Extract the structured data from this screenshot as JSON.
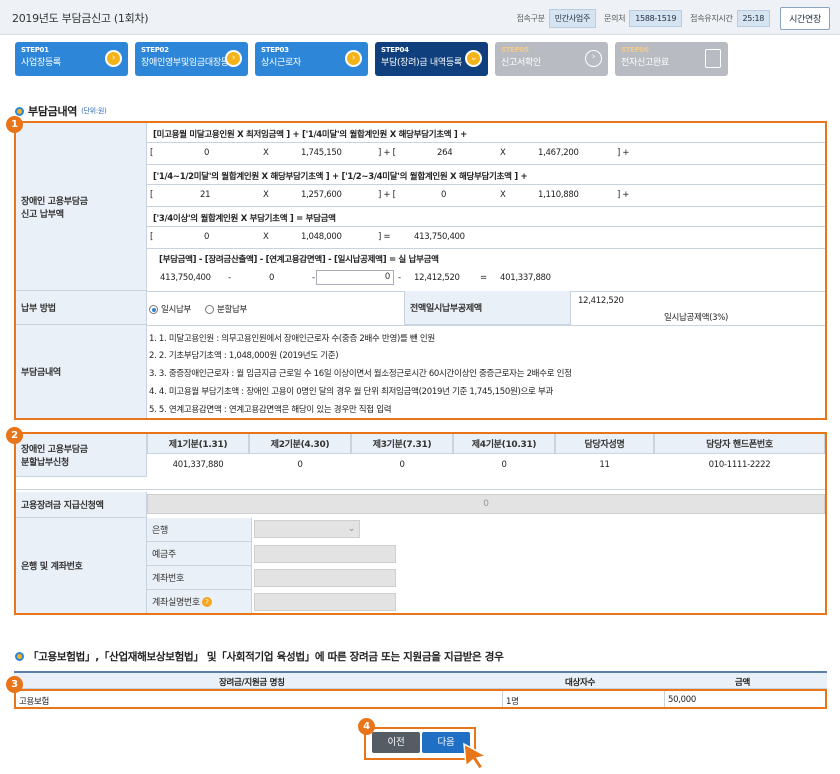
{
  "header": {
    "title": "2019년도 부담금신고 (1회차)",
    "info": [
      {
        "label": "접속구분",
        "value": "민간사업주"
      },
      {
        "label": "문의처",
        "value": "1588-1519"
      },
      {
        "label": "접속유지시간",
        "value": "25:18"
      }
    ],
    "extend": "시간연장"
  },
  "steps": [
    {
      "no": "STEP01",
      "name": "사업장등록"
    },
    {
      "no": "STEP02",
      "name": "장애인영부및임금대장등록"
    },
    {
      "no": "STEP03",
      "name": "상시근로자"
    },
    {
      "no": "STEP04",
      "name": "부담(장려)금 내역등록"
    },
    {
      "no": "STEP05",
      "name": "신고서확인"
    },
    {
      "no": "STEP06",
      "name": "전자신고완료"
    }
  ],
  "section1": {
    "title": "부담금내역",
    "unit": "(단위:원)"
  },
  "badges": [
    "1",
    "2",
    "3",
    "4"
  ],
  "calc": {
    "label": "장애인 고용부담금\n신고 납부액",
    "f1": "[미고용월 미달고용인원 X  최저임금액  ] + ['1/4미달'의 월합계인원 X   해당부담기초액  ] +",
    "r1": [
      "[",
      "0",
      "X",
      "1,745,150",
      "] + [",
      "264",
      "X",
      "1,467,200",
      "] +"
    ],
    "f2": "['1/4~1/2미달'의 월합계인원 X   해당부담기초액  ] + ['1/2~3/4미달'의 월합계인원 X   해당부담기초액  ] +",
    "r2": [
      "[",
      "21",
      "X",
      "1,257,600",
      "] + [",
      "0",
      "X",
      "1,110,880",
      "] +"
    ],
    "f3": "['3/4이상'의 월합계인원 X   부담기초액  ] =   부담금액",
    "r3": [
      "[",
      "0",
      "X",
      "1,048,000",
      "] =",
      "413,750,400"
    ],
    "f4": "[부담금액]   -  [장려금산출액]  -  [연계고용감면액]  -  [일시납공제액]  =   실 납부금액",
    "r4": [
      "413,750,400",
      "-",
      "0",
      "-",
      "0",
      "-",
      "12,412,520",
      "=",
      "401,337,880"
    ]
  },
  "pay": {
    "label": "납부 방법",
    "opt1": "일시납부",
    "opt2": "분할납부",
    "deductLabel": "전액일시납부공제액",
    "deductVal": "12,412,520",
    "deductNote": "일시납공제액(3%)"
  },
  "notes": {
    "label": "부담금내역",
    "items": [
      "1. 1. 미달고용인원 : 의무고용인원에서 장애인근로자 수(중증 2배수 반영)를 뺀 인원",
      "2. 2. 기초부담기초액 : 1,048,000원 (2019년도 기준)",
      "3. 3. 중증장애인근로자 : 월 임금지급 근로일 수 16일 이상이면서 월소정근로시간 60시간이상인 중증근로자는 2배수로 인정",
      "4. 4. 미고용월 부담기초액 : 장애인 고용이 0명인 달의 경우 월 단위 최저임금액(2019년 기준 1,745,150원)으로 부과",
      "5. 5. 연계고용감면액 : 연계고용감면액은 해당이 있는 경우만 직접 입력"
    ]
  },
  "install": {
    "label": "장애인 고용부담금\n분할납부신청",
    "headers": [
      "제1기분(1.31)",
      "제2기분(4.30)",
      "제3기분(7.31)",
      "제4기분(10.31)",
      "담당자성명",
      "담당자 핸드폰번호"
    ],
    "values": [
      "401,337,880",
      "0",
      "0",
      "0",
      "11",
      "010-1111-2222"
    ]
  },
  "subsidy": {
    "label": "고용장려금 지급신청액",
    "value": "0"
  },
  "bank": {
    "label": "은행 및 계좌번호",
    "rows": [
      "은행",
      "예금주",
      "계좌번호",
      "계좌실명번호"
    ]
  },
  "section2": {
    "title": "「고용보험법」,「산업재해보상보험법」 및「사회적기업 육성법」에 따른 장려금 또는 지원금을 지급받은 경우"
  },
  "table3": {
    "headers": [
      "장려금/지원금 명칭",
      "대상자수",
      "금액"
    ],
    "row": [
      "고용보험",
      "1명",
      "50,000"
    ]
  },
  "buttons": {
    "prev": "이전",
    "next": "다음"
  }
}
